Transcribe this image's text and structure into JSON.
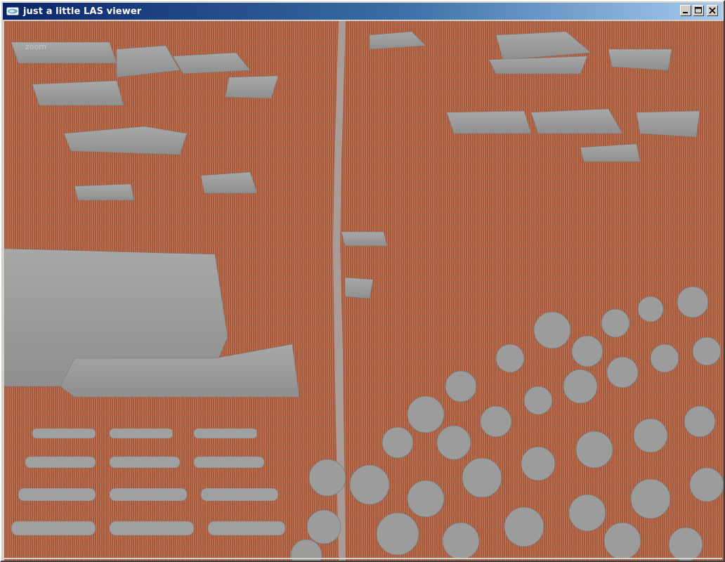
{
  "window": {
    "title": "just a little LAS viewer",
    "icons": {
      "app": "app-icon",
      "minimize": "minimize-icon",
      "maximize": "maximize-icon",
      "close": "close-icon"
    }
  },
  "viewport": {
    "overlay_label": "zoom",
    "colors": {
      "ground_points": "#b4552f",
      "surface": "#9a9a9a"
    }
  }
}
